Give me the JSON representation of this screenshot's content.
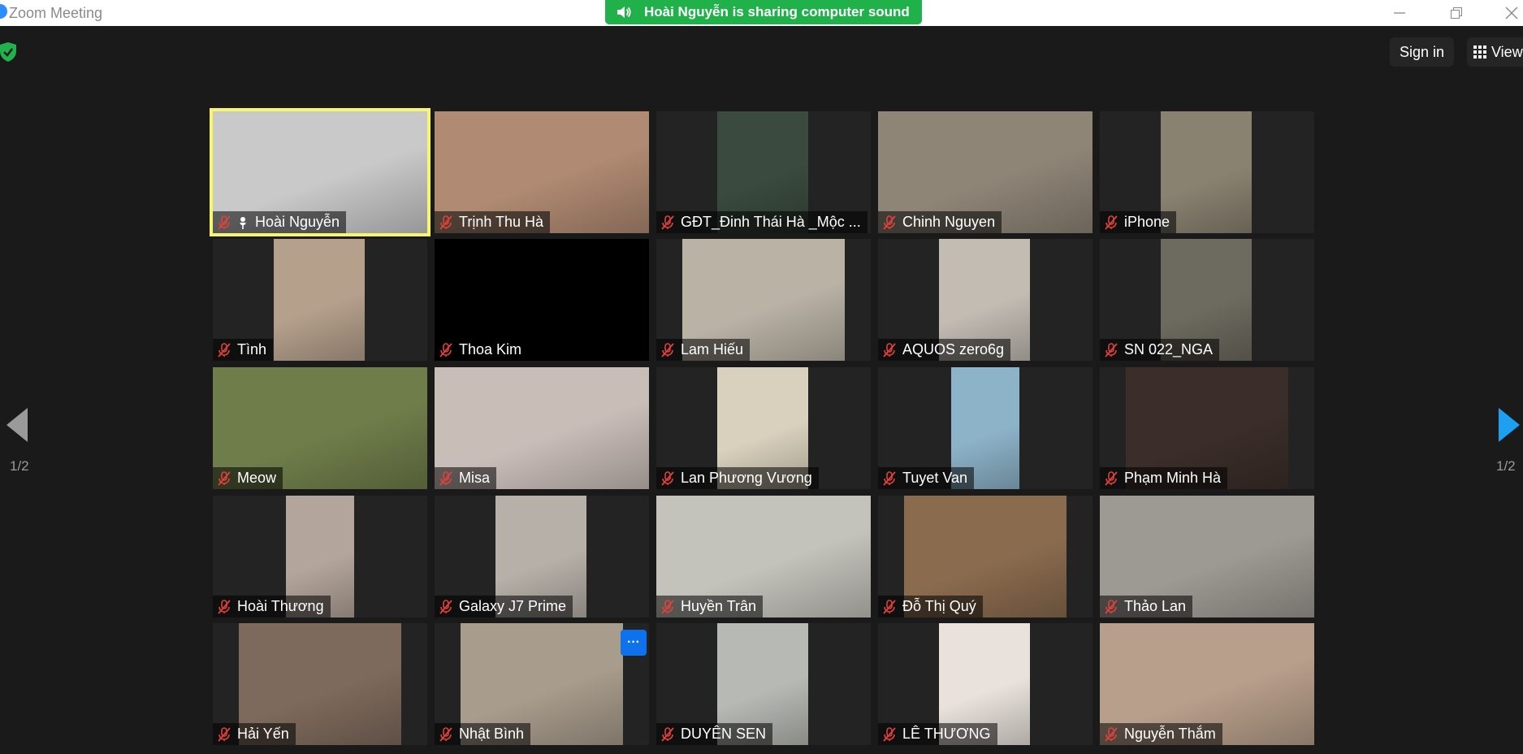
{
  "window": {
    "title": "Zoom Meeting"
  },
  "banner": {
    "text": "Hoài Nguyễn is sharing computer sound"
  },
  "header": {
    "sign_in": "Sign in",
    "view": "View"
  },
  "pager": {
    "left": "1/2",
    "right": "1/2"
  },
  "participants": [
    {
      "name": "Hoài Nguyễn",
      "active": true,
      "pinned": true,
      "bg": "#c9c9c9",
      "vid": [
        0,
        264
      ]
    },
    {
      "name": "Trịnh Thu Hà",
      "bg": "#b08a72",
      "vid": [
        0,
        264
      ]
    },
    {
      "name": "GĐT_Đinh Thái Hà _Mộc ...",
      "bg": "#3a4a3e",
      "vid": [
        75,
        112
      ]
    },
    {
      "name": "Chinh Nguyen",
      "bg": "#8f8577",
      "vid": [
        0,
        264
      ]
    },
    {
      "name": "iPhone",
      "bg": "#8a8271",
      "vid": [
        75,
        112
      ]
    },
    {
      "name": "Tình",
      "bg": "#b5a08c",
      "vid": [
        75,
        112
      ]
    },
    {
      "name": "Thoa Kim",
      "bg": "#000000",
      "vid": [
        0,
        264
      ]
    },
    {
      "name": "Lam Hiếu",
      "bg": "#b9b2a5",
      "vid": [
        32,
        200
      ]
    },
    {
      "name": "AQUOS zero6g",
      "bg": "#c2bcb3",
      "vid": [
        75,
        112
      ]
    },
    {
      "name": "SN 022_NGA",
      "bg": "#6d6b5f",
      "vid": [
        75,
        112
      ]
    },
    {
      "name": "Meow",
      "bg": "#6f7d4a",
      "vid": [
        0,
        264
      ]
    },
    {
      "name": "Misa",
      "bg": "#c9bdb8",
      "vid": [
        0,
        264
      ]
    },
    {
      "name": "Lan Phương Vương",
      "bg": "#d9d1bd",
      "vid": [
        75,
        112
      ]
    },
    {
      "name": "Tuyet Van",
      "bg": "#8db3c9",
      "vid": [
        90,
        84
      ]
    },
    {
      "name": "Phạm Minh Hà",
      "bg": "#3b2e2a",
      "vid": [
        32,
        200
      ]
    },
    {
      "name": "Hoài Thương",
      "bg": "#b3a59b",
      "vid": [
        90,
        84
      ]
    },
    {
      "name": "Galaxy J7 Prime",
      "bg": "#b6b0a8",
      "vid": [
        75,
        112
      ]
    },
    {
      "name": "Huyền Trân",
      "bg": "#c3c2bb",
      "vid": [
        0,
        264
      ]
    },
    {
      "name": "Đỗ Thị Quý",
      "bg": "#8a6b4e",
      "vid": [
        32,
        200
      ]
    },
    {
      "name": "Thảo Lan",
      "bg": "#9d9a93",
      "vid": [
        0,
        264
      ]
    },
    {
      "name": "Hải Yến",
      "bg": "#7e6a5c",
      "vid": [
        32,
        200
      ]
    },
    {
      "name": "Nhật Bình",
      "bg": "#a89c8c",
      "vid": [
        32,
        200
      ],
      "more": "···"
    },
    {
      "name": "DUYÊN SEN",
      "bg": "#b7b9b4",
      "vid": [
        75,
        112
      ]
    },
    {
      "name": "LÊ THƯƠNG",
      "bg": "#e9e2dc",
      "vid": [
        75,
        112
      ]
    },
    {
      "name": "Nguyễn Thắm",
      "bg": "#b89f8b",
      "vid": [
        0,
        264
      ]
    }
  ]
}
